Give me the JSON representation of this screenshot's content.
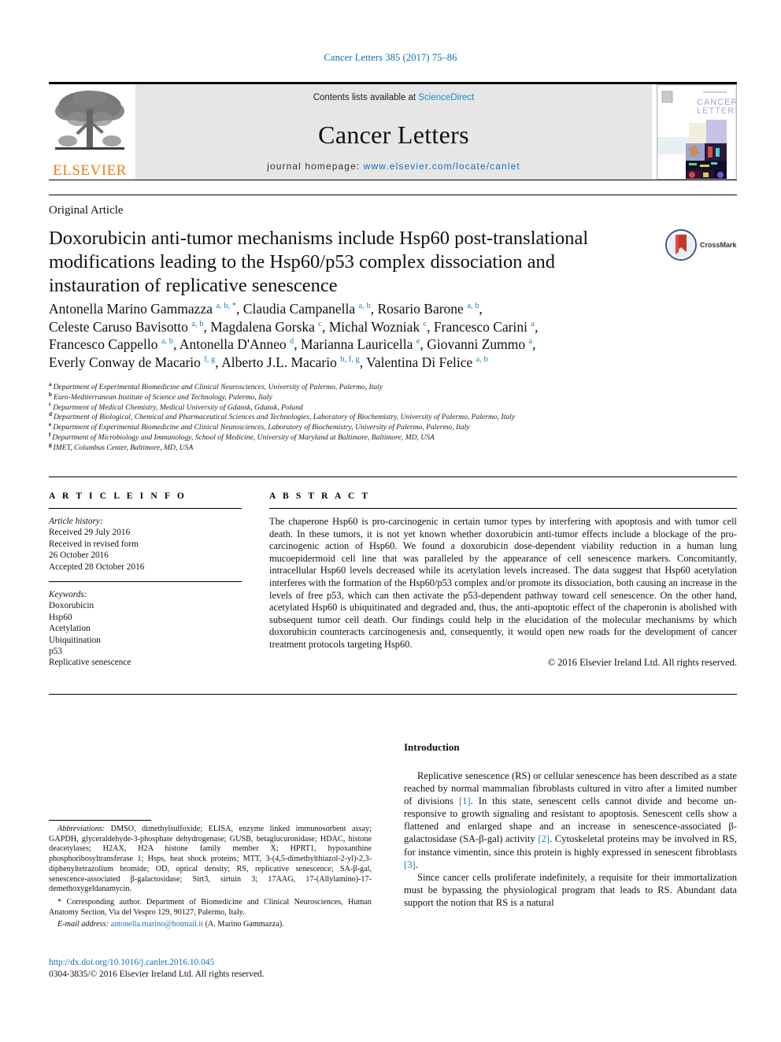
{
  "running_head": "Cancer Letters 385 (2017) 75–86",
  "masthead": {
    "contents_prefix": "Contents lists available at ",
    "sciencedirect": "ScienceDirect",
    "journal_title": "Cancer Letters",
    "homepage_label": "journal homepage: ",
    "homepage_url": "www.elsevier.com/locate/canlet",
    "publisher": "ELSEVIER",
    "cover_title_line1": "CANCER",
    "cover_title_line2": "LETTERS",
    "accent_blue": "#1a8fc4",
    "link_blue": "#1a6fbd",
    "elsevier_orange": "#f07d1a"
  },
  "article_type": "Original Article",
  "title": "Doxorubicin anti-tumor mechanisms include Hsp60 post-translational modifications leading to the Hsp60/p53 complex dissociation and instauration of replicative senescence",
  "crossmark_label": "CrossMark",
  "authors_html": "Antonella Marino Gammazza <sup>a, b, *</sup>, Claudia Campanella <sup>a, b</sup>, Rosario Barone <sup>a, b</sup>,<br>Celeste Caruso Bavisotto <sup>a, b</sup>, Magdalena Gorska <sup>c</sup>, Michal Wozniak <sup>c</sup>, Francesco Carini <sup>a</sup>,<br>Francesco Cappello <sup>a, b</sup>, Antonella D'Anneo <sup>d</sup>, Marianna Lauricella <sup>e</sup>, Giovanni Zummo <sup>a</sup>,<br>Everly Conway de Macario <sup>f, g</sup>, Alberto J.L. Macario <sup>b, f, g</sup>, Valentina Di Felice <sup>a, b</sup>",
  "affiliations": [
    {
      "mark": "a",
      "text": "Department of Experimental Biomedicine and Clinical Neurosciences, University of Palermo, Palermo, Italy"
    },
    {
      "mark": "b",
      "text": "Euro-Mediterranean Institute of Science and Technology, Palermo, Italy"
    },
    {
      "mark": "c",
      "text": "Department of Medical Chemistry, Medical University of Gdansk, Gdansk, Poland"
    },
    {
      "mark": "d",
      "text": "Department of Biological, Chemical and Pharmaceutical Sciences and Technologies, Laboratory of Biochemistry, University of Palermo, Palermo, Italy"
    },
    {
      "mark": "e",
      "text": "Department of Experimental Biomedicine and Clinical Neurosciences, Laboratory of Biochemistry, University of Palermo, Palermo, Italy"
    },
    {
      "mark": "f",
      "text": "Department of Microbiology and Immunology, School of Medicine, University of Maryland at Baltimore, Baltimore, MD, USA"
    },
    {
      "mark": "g",
      "text": "IMET, Columbus Center, Baltimore, MD, USA"
    }
  ],
  "article_info": {
    "heading": "A R T I C L E  I N F O",
    "history_label": "Article history:",
    "history_lines": [
      "Received 29 July 2016",
      "Received in revised form",
      "26 October 2016",
      "Accepted 28 October 2016"
    ],
    "keywords_label": "Keywords:",
    "keywords": [
      "Doxorubicin",
      "Hsp60",
      "Acetylation",
      "Ubiquitination",
      "p53",
      "Replicative senescence"
    ]
  },
  "abstract": {
    "heading": "A B S T R A C T",
    "text": "The chaperone Hsp60 is pro-carcinogenic in certain tumor types by interfering with apoptosis and with tumor cell death. In these tumors, it is not yet known whether doxorubicin anti-tumor effects include a blockage of the pro-carcinogenic action of Hsp60. We found a doxorubicin dose-dependent viability reduction in a human lung mucoepidermoid cell line that was paralleled by the appearance of cell senescence markers. Concomitantly, intracellular Hsp60 levels decreased while its acetylation levels increased. The data suggest that Hsp60 acetylation interferes with the formation of the Hsp60/p53 complex and/or promote its dissociation, both causing an increase in the levels of free p53, which can then activate the p53-dependent pathway toward cell senescence. On the other hand, acetylated Hsp60 is ubiquitinated and degraded and, thus, the anti-apoptotic effect of the chaperonin is abolished with subsequent tumor cell death. Our findings could help in the elucidation of the molecular mechanisms by which doxorubicin counteracts carcinogenesis and, consequently, it would open new roads for the development of cancer treatment protocols targeting Hsp60.",
    "copyright": "© 2016 Elsevier Ireland Ltd. All rights reserved."
  },
  "footnotes": {
    "abbreviations_label": "Abbreviations:",
    "abbreviations_text": " DMSO, dimethylsulfoxide; ELISA, enzyme linked immunosorbent assay; GAPDH, glyceraldehyde-3-phosphate dehydrogenase; GUSB, betaglucuronidase; HDAC, histone deacetylases; H2AX, H2A histone family member X; HPRT1, hypoxanthine phosphoribosyltransferase 1; Hsps, heat shock proteins; MTT, 3-(4,5-dimethylthiazol-2-yl)-2,3-diphenyltetrazolium bromide; OD, optical density; RS, replicative senescence; SA-β-gal, senescence-associated β-galactosidase; Sirt3, sirtuin 3; 17AAG, 17-(Allylamino)-17-demethoxygeldanamycin.",
    "corresponding_marker": "*",
    "corresponding_text": " Corresponding author. Department of Biomedicine and Clinical Neurosciences, Human Anatomy Section, Via del Vespro 129, 90127, Palermo, Italy.",
    "email_label": "E-mail address:",
    "email": "antonella.marino@hotmail.it",
    "email_suffix": " (A. Marino Gammazza)."
  },
  "doi_block": {
    "doi_url": "http://dx.doi.org/10.1016/j.canlet.2016.10.045",
    "issn_line": "0304-3835/© 2016 Elsevier Ireland Ltd. All rights reserved."
  },
  "introduction": {
    "heading": "Introduction",
    "paragraph1_a": "Replicative senescence (RS) or cellular senescence has been described as a state reached by normal mammalian fibroblasts cultured in vitro after a limited number of divisions ",
    "ref1": "[1]",
    "paragraph1_b": ". In this state, senescent cells cannot divide and become un-responsive to growth signaling and resistant to apoptosis. Senescent cells show a flattened and enlarged shape and an increase in senescence-associated β-galactosidase (SA-β-gal) activity ",
    "ref2": "[2]",
    "paragraph1_c": ". Cytoskeletal proteins may be involved in RS, for instance vimentin, since this protein is highly expressed in senescent fibroblasts ",
    "ref3": "[3]",
    "paragraph1_d": ".",
    "paragraph2": "Since cancer cells proliferate indefinitely, a requisite for their immortalization must be bypassing the physiological program that leads to RS. Abundant data support the notion that RS is a natural"
  }
}
